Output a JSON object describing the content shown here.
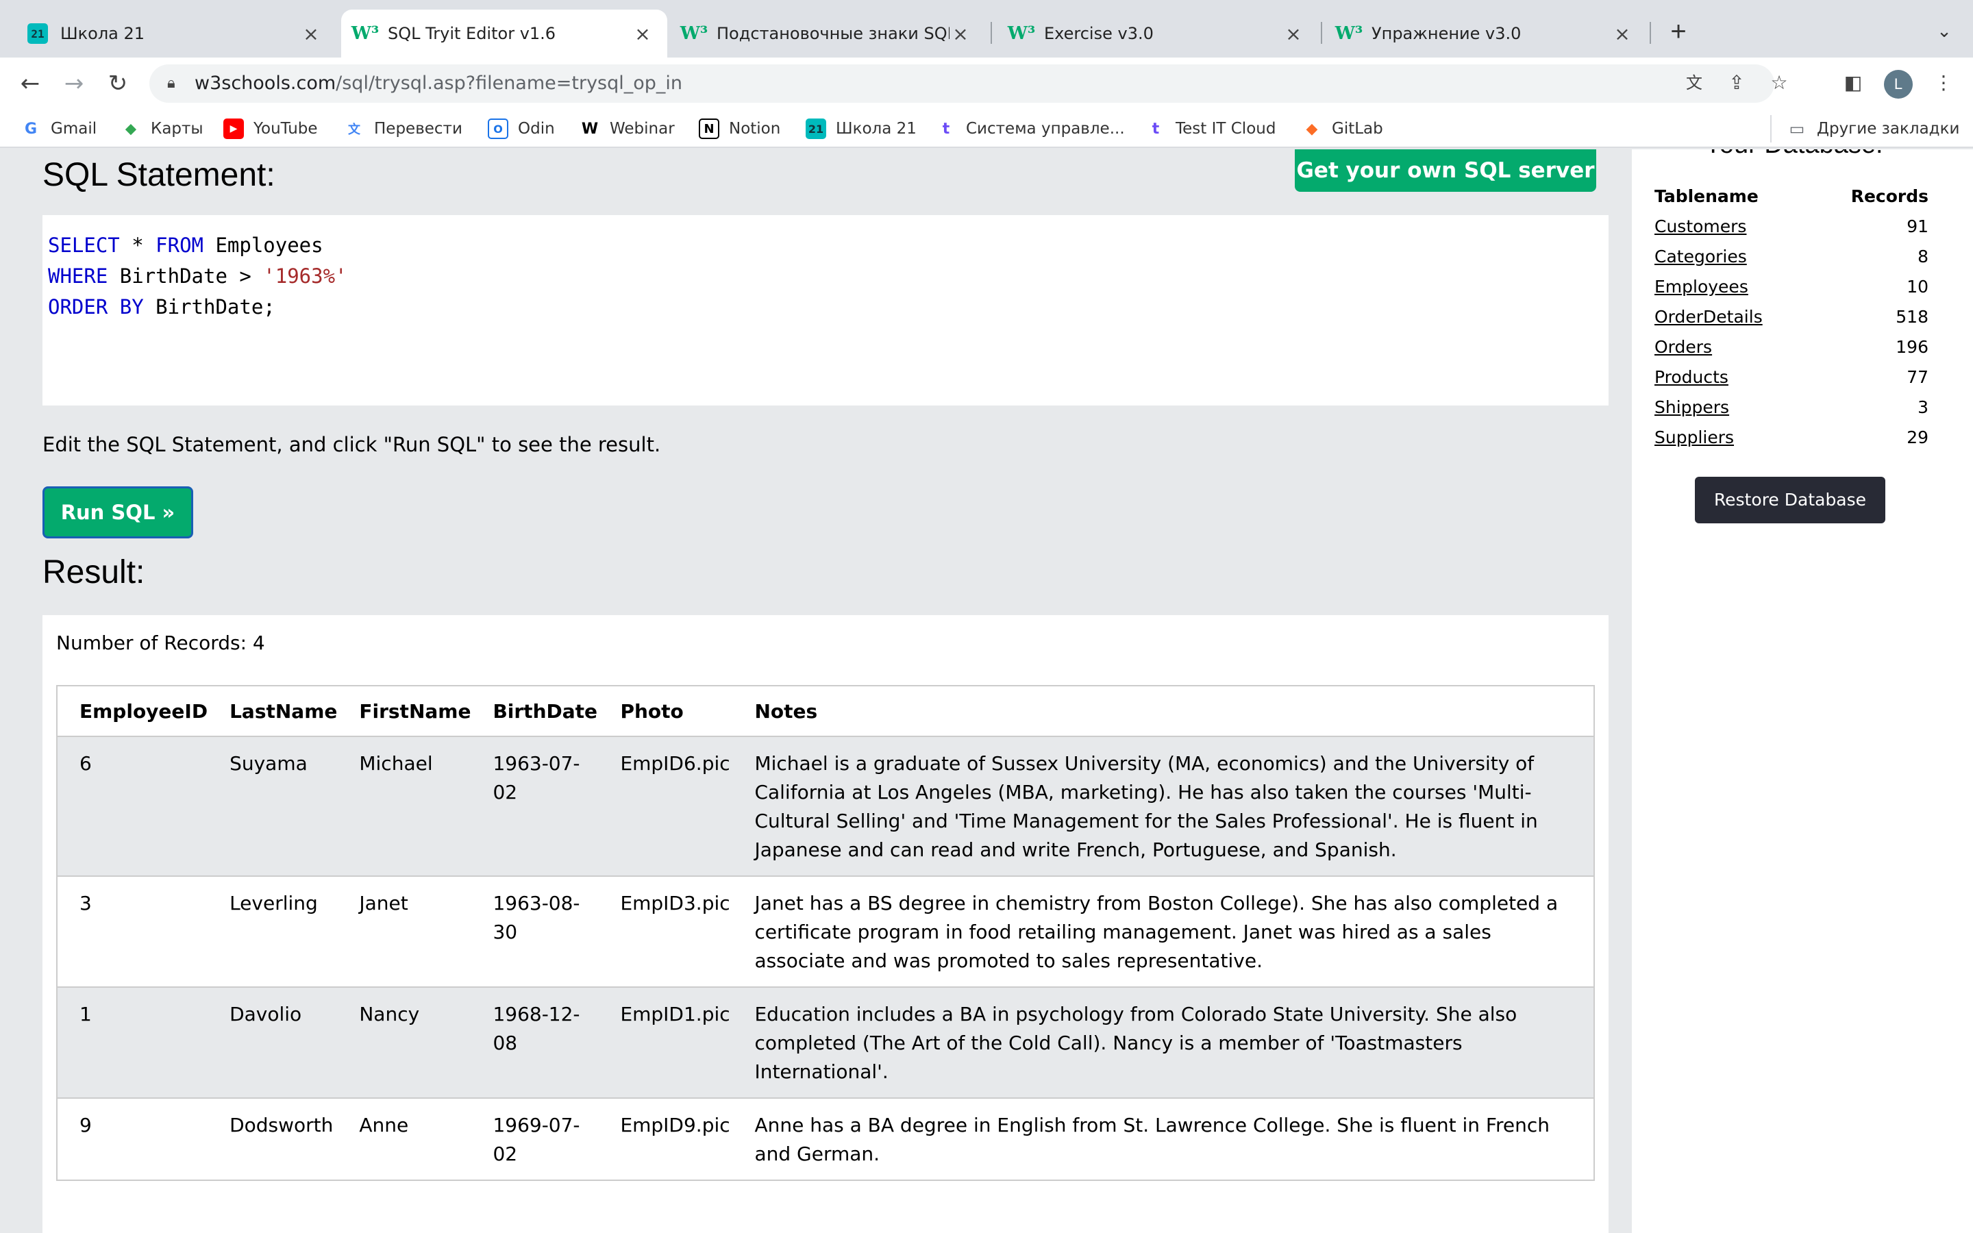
{
  "browser": {
    "tabs": [
      {
        "title": "Школа 21",
        "favicon": "school21",
        "active": false
      },
      {
        "title": "SQL Tryit Editor v1.6",
        "favicon": "w3schools",
        "active": true
      },
      {
        "title": "Подстановочные знаки SQL",
        "favicon": "w3schools",
        "active": false
      },
      {
        "title": "Exercise v3.0",
        "favicon": "w3schools",
        "active": false
      },
      {
        "title": "Упражнение v3.0",
        "favicon": "w3schools",
        "active": false
      }
    ],
    "url_host": "w3schools.com",
    "url_path": "/sql/trysql.asp?filename=trysql_op_in",
    "avatar_letter": "L",
    "bookmarks": [
      {
        "label": "Gmail",
        "icon": "gmail-icon"
      },
      {
        "label": "Карты",
        "icon": "maps-icon"
      },
      {
        "label": "YouTube",
        "icon": "youtube-icon"
      },
      {
        "label": "Перевести",
        "icon": "translate-icon"
      },
      {
        "label": "Odin",
        "icon": "odin-icon"
      },
      {
        "label": "Webinar",
        "icon": "webinar-icon"
      },
      {
        "label": "Notion",
        "icon": "notion-icon"
      },
      {
        "label": "Школа 21",
        "icon": "school21-icon"
      },
      {
        "label": "Система управле...",
        "icon": "testit-icon"
      },
      {
        "label": "Test IT Cloud",
        "icon": "testit-icon"
      },
      {
        "label": "GitLab",
        "icon": "gitlab-icon"
      }
    ],
    "other_bookmarks": "Другие закладки"
  },
  "editor": {
    "title": "SQL Statement:",
    "get_server_label": "Get your own SQL server",
    "hint": "Edit the SQL Statement, and click \"Run SQL\" to see the result.",
    "run_label": "Run SQL »",
    "line1_kw1": "SELECT",
    "line1_rest1": " * ",
    "line1_kw2": "FROM",
    "line1_rest2": " Employees",
    "line2_kw": "WHERE",
    "line2_rest": " BirthDate > ",
    "line2_str": "'1963%'",
    "line3_kw": "ORDER BY",
    "line3_rest": " BirthDate;"
  },
  "result": {
    "title": "Result:",
    "record_count": "Number of Records: 4",
    "columns": [
      "EmployeeID",
      "LastName",
      "FirstName",
      "BirthDate",
      "Photo",
      "Notes"
    ],
    "rows": [
      {
        "id": "6",
        "last": "Suyama",
        "first": "Michael",
        "birth": "1963-07-02",
        "photo": "EmpID6.pic",
        "notes": "Michael is a graduate of Sussex University (MA, economics) and the University of California at Los Angeles (MBA, marketing). He has also taken the courses 'Multi-Cultural Selling' and 'Time Management for the Sales Professional'. He is fluent in Japanese and can read and write French, Portuguese, and Spanish."
      },
      {
        "id": "3",
        "last": "Leverling",
        "first": "Janet",
        "birth": "1963-08-30",
        "photo": "EmpID3.pic",
        "notes": "Janet has a BS degree in chemistry from Boston College). She has also completed a certificate program in food retailing management. Janet was hired as a sales associate and was promoted to sales representative."
      },
      {
        "id": "1",
        "last": "Davolio",
        "first": "Nancy",
        "birth": "1968-12-08",
        "photo": "EmpID1.pic",
        "notes": "Education includes a BA in psychology from Colorado State University. She also completed (The Art of the Cold Call). Nancy is a member of 'Toastmasters International'."
      },
      {
        "id": "9",
        "last": "Dodsworth",
        "first": "Anne",
        "birth": "1969-07-02",
        "photo": "EmpID9.pic",
        "notes": "Anne has a BA degree in English from St. Lawrence College. She is fluent in French and German."
      }
    ]
  },
  "database": {
    "title": "Your Database:",
    "col_name": "Tablename",
    "col_records": "Records",
    "tables": [
      {
        "name": "Customers",
        "records": "91"
      },
      {
        "name": "Categories",
        "records": "8"
      },
      {
        "name": "Employees",
        "records": "10"
      },
      {
        "name": "OrderDetails",
        "records": "518"
      },
      {
        "name": "Orders",
        "records": "196"
      },
      {
        "name": "Products",
        "records": "77"
      },
      {
        "name": "Shippers",
        "records": "3"
      },
      {
        "name": "Suppliers",
        "records": "29"
      }
    ],
    "restore_label": "Restore Database"
  },
  "colors": {
    "accent_green": "#04aa6d",
    "keyword_blue": "#0000cd",
    "string_brown": "#a52a2a",
    "dark_button": "#282a35"
  }
}
